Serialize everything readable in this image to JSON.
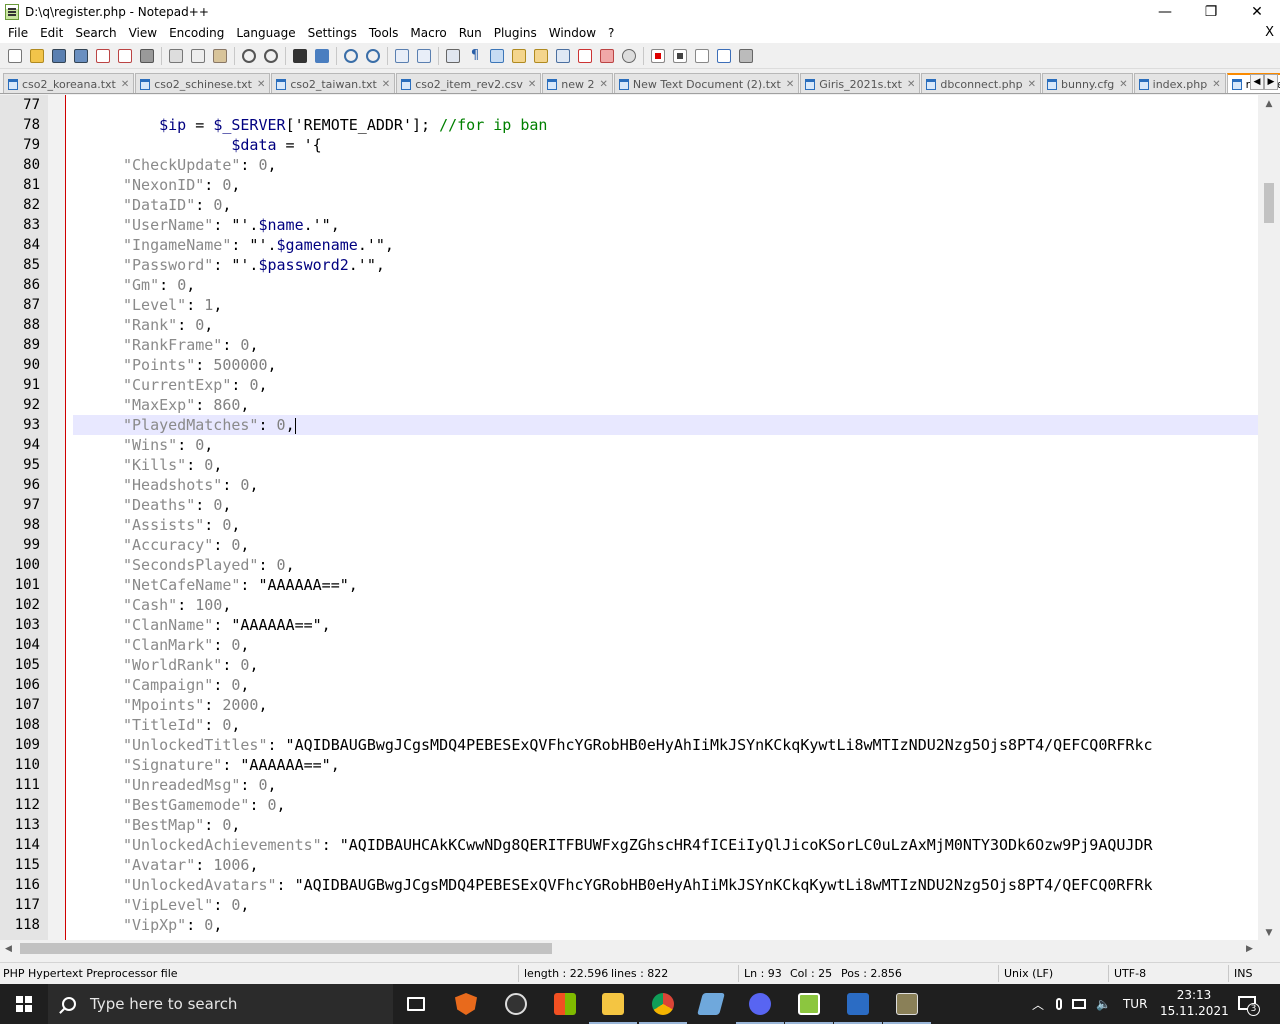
{
  "window": {
    "title": "D:\\q\\register.php - Notepad++",
    "minimize": "—",
    "maximize": "❐",
    "close": "✕"
  },
  "menu": {
    "items": [
      "File",
      "Edit",
      "Search",
      "View",
      "Encoding",
      "Language",
      "Settings",
      "Tools",
      "Macro",
      "Run",
      "Plugins",
      "Window",
      "?"
    ],
    "close_doc": "X"
  },
  "tabs": [
    {
      "label": "cso2_koreana.txt",
      "active": false
    },
    {
      "label": "cso2_schinese.txt",
      "active": false
    },
    {
      "label": "cso2_taiwan.txt",
      "active": false
    },
    {
      "label": "cso2_item_rev2.csv",
      "active": false
    },
    {
      "label": "new 2",
      "active": false
    },
    {
      "label": "New Text Document (2).txt",
      "active": false
    },
    {
      "label": "Giris_2021s.txt",
      "active": false
    },
    {
      "label": "dbconnect.php",
      "active": false
    },
    {
      "label": "bunny.cfg",
      "active": false
    },
    {
      "label": "index.php",
      "active": false
    },
    {
      "label": "register.php",
      "active": true
    }
  ],
  "tab_close_glyph": "✕",
  "editor": {
    "current_line": 93,
    "lines": [
      {
        "n": "77",
        "text": ""
      },
      {
        "n": "78",
        "text": "    $ip = $_SERVER['REMOTE_ADDR']; //for ip ban"
      },
      {
        "n": "79",
        "text": "            $data = '{"
      },
      {
        "n": "80",
        "text": "\"CheckUpdate\": 0,"
      },
      {
        "n": "81",
        "text": "\"NexonID\": 0,"
      },
      {
        "n": "82",
        "text": "\"DataID\": 0,"
      },
      {
        "n": "83",
        "text": "\"UserName\": \"'.$name.'\","
      },
      {
        "n": "84",
        "text": "\"IngameName\": \"'.$gamename.'\","
      },
      {
        "n": "85",
        "text": "\"Password\": \"'.$password2.'\","
      },
      {
        "n": "86",
        "text": "\"Gm\": 0,"
      },
      {
        "n": "87",
        "text": "\"Level\": 1,"
      },
      {
        "n": "88",
        "text": "\"Rank\": 0,"
      },
      {
        "n": "89",
        "text": "\"RankFrame\": 0,"
      },
      {
        "n": "90",
        "text": "\"Points\": 500000,"
      },
      {
        "n": "91",
        "text": "\"CurrentExp\": 0,"
      },
      {
        "n": "92",
        "text": "\"MaxExp\": 860,"
      },
      {
        "n": "93",
        "text": "\"PlayedMatches\": 0,"
      },
      {
        "n": "94",
        "text": "\"Wins\": 0,"
      },
      {
        "n": "95",
        "text": "\"Kills\": 0,"
      },
      {
        "n": "96",
        "text": "\"Headshots\": 0,"
      },
      {
        "n": "97",
        "text": "\"Deaths\": 0,"
      },
      {
        "n": "98",
        "text": "\"Assists\": 0,"
      },
      {
        "n": "99",
        "text": "\"Accuracy\": 0,"
      },
      {
        "n": "100",
        "text": "\"SecondsPlayed\": 0,"
      },
      {
        "n": "101",
        "text": "\"NetCafeName\": \"AAAAAA==\","
      },
      {
        "n": "102",
        "text": "\"Cash\": 100,"
      },
      {
        "n": "103",
        "text": "\"ClanName\": \"AAAAAA==\","
      },
      {
        "n": "104",
        "text": "\"ClanMark\": 0,"
      },
      {
        "n": "105",
        "text": "\"WorldRank\": 0,"
      },
      {
        "n": "106",
        "text": "\"Campaign\": 0,"
      },
      {
        "n": "107",
        "text": "\"Mpoints\": 2000,"
      },
      {
        "n": "108",
        "text": "\"TitleId\": 0,"
      },
      {
        "n": "109",
        "text": "\"UnlockedTitles\": \"AQIDBAUGBwgJCgsMDQ4PEBESExQVFhcYGRobHB0eHyAhIiMkJSYnKCkqKywtLi8wMTIzNDU2Nzg5Ojs8PT4/QEFCQ0RFRkc"
      },
      {
        "n": "110",
        "text": "\"Signature\": \"AAAAAA==\","
      },
      {
        "n": "111",
        "text": "\"UnreadedMsg\": 0,"
      },
      {
        "n": "112",
        "text": "\"BestGamemode\": 0,"
      },
      {
        "n": "113",
        "text": "\"BestMap\": 0,"
      },
      {
        "n": "114",
        "text": "\"UnlockedAchievements\": \"AQIDBAUHCAkKCwwNDg8QERITFBUWFxgZGhscHR4fICEiIyQlJicoKSorLC0uLzAxMjM0NTY3ODk6Ozw9Pj9AQUJDR"
      },
      {
        "n": "115",
        "text": "\"Avatar\": 1006,"
      },
      {
        "n": "116",
        "text": "\"UnlockedAvatars\": \"AQIDBAUGBwgJCgsMDQ4PEBESExQVFhcYGRobHB0eHyAhIiMkJSYnKCkqKywtLi8wMTIzNDU2Nzg5Ojs8PT4/QEFCQ0RFRk"
      },
      {
        "n": "117",
        "text": "\"VipLevel\": 0,"
      },
      {
        "n": "118",
        "text": "\"VipXp\": 0,"
      }
    ]
  },
  "statusbar": {
    "filetype": "PHP Hypertext Preprocessor file",
    "length": "length : 22.596",
    "lines": "lines : 822",
    "ln": "Ln : 93",
    "col": "Col : 25",
    "pos": "Pos : 2.856",
    "eol": "Unix (LF)",
    "encoding": "UTF-8",
    "mode": "INS"
  },
  "taskbar": {
    "search_placeholder": "Type here to search",
    "language": "TUR",
    "time": "23:13",
    "date": "15.11.2021",
    "notification_count": "3"
  },
  "colors": {
    "string": "#808080",
    "keyword": "#000080",
    "comment": "#008000",
    "current_line": "#e8e8ff",
    "active_tab_accent": "#fa8a00"
  }
}
